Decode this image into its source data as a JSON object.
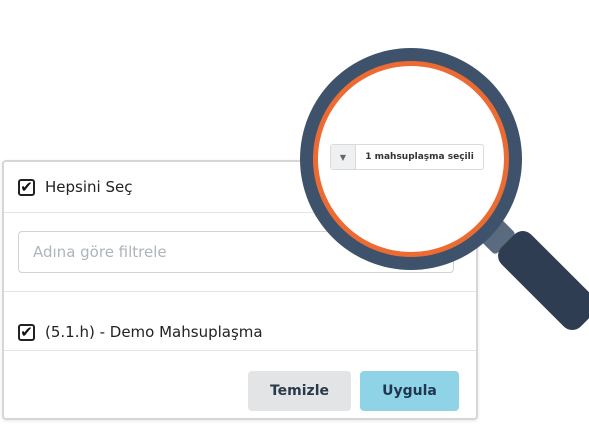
{
  "panel": {
    "select_all": {
      "label": "Hepsini Seç",
      "checked": true
    },
    "filter": {
      "placeholder": "Adına göre filtrele",
      "value": ""
    },
    "items": [
      {
        "label": "(5.1.h) - Demo Mahsuplaşma",
        "checked": true
      }
    ],
    "buttons": {
      "clear": "Temizle",
      "apply": "Uygula"
    }
  },
  "magnifier": {
    "select_summary": "1 mahsuplaşma seçili",
    "caret": "▼"
  },
  "icons": {
    "check": "✔"
  },
  "colors": {
    "apply_button": "#8fd4e6",
    "clear_button": "#e2e4e6",
    "lens_ring": "#3f526b",
    "lens_accent": "#ec6b33",
    "handle": "#2e3d52"
  }
}
